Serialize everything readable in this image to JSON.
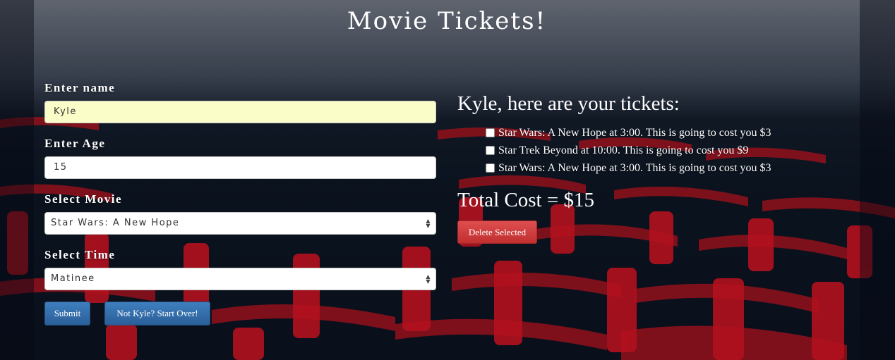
{
  "page": {
    "title": "Movie Tickets!"
  },
  "form": {
    "name_label": "Enter name",
    "name_value": "Kyle",
    "age_label": "Enter Age",
    "age_value": "15",
    "movie_label": "Select Movie",
    "movie_value": "Star Wars: A New Hope",
    "time_label": "Select Time",
    "time_value": "Matinee",
    "submit_label": "Submit",
    "restart_label": "Not Kyle? Start Over!"
  },
  "tickets": {
    "heading": "Kyle, here are your tickets:",
    "items": [
      {
        "label": "Star Wars: A New Hope at 3:00. This is going to cost you $3",
        "checked": false
      },
      {
        "label": "Star Trek Beyond at 10:00. This is going to cost you $9",
        "checked": false
      },
      {
        "label": "Star Wars: A New Hope at 3:00. This is going to cost you $3",
        "checked": false
      }
    ],
    "total": "Total Cost = $15",
    "delete_label": "Delete Selected"
  },
  "colors": {
    "primary_button": "#2f6aa8",
    "danger_button": "#d43f3f",
    "seat_red": "#c0141e"
  }
}
